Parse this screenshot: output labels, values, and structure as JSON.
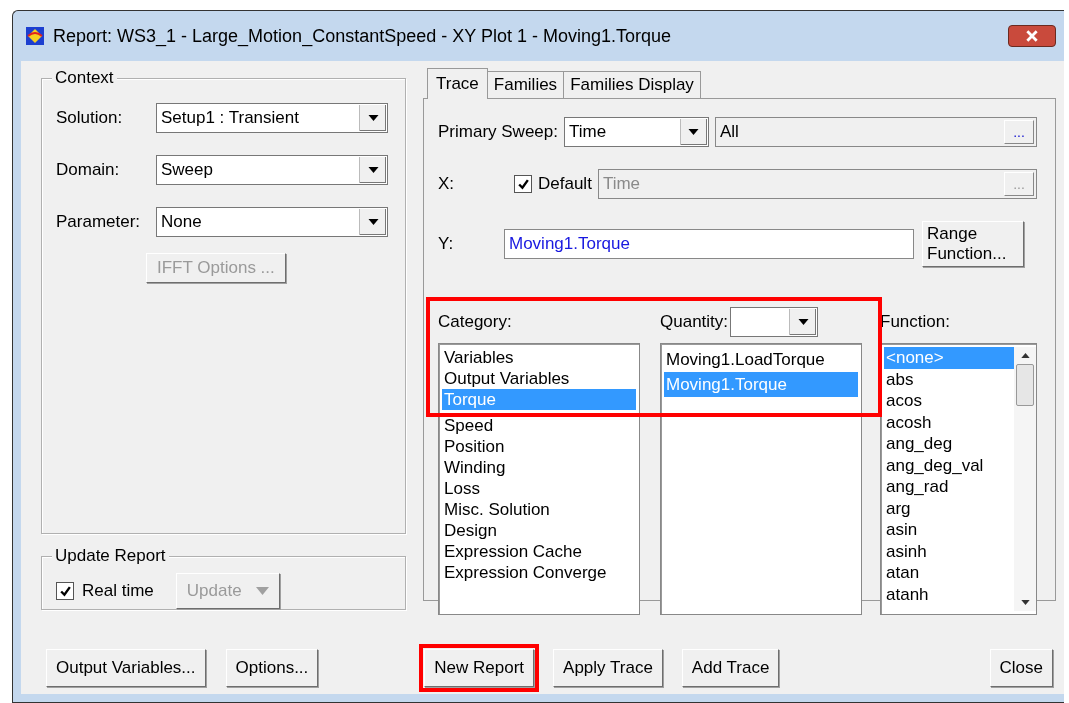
{
  "window": {
    "title": "Report: WS3_1 - Large_Motion_ConstantSpeed - XY Plot 1 - Moving1.Torque"
  },
  "context": {
    "legend": "Context",
    "fields": [
      {
        "label": "Solution:",
        "value": "Setup1 : Transient"
      },
      {
        "label": "Domain:",
        "value": "Sweep"
      },
      {
        "label": "Parameter:",
        "value": "None"
      }
    ],
    "ifft_button": {
      "label": "IFFT Options ...",
      "disabled": true
    }
  },
  "update_report": {
    "legend": "Update Report",
    "real_time": {
      "label": "Real time",
      "checked": true
    },
    "update_button": {
      "label": "Update",
      "disabled": true
    }
  },
  "tabs": [
    {
      "label": "Trace",
      "selected": true
    },
    {
      "label": "Families",
      "selected": false
    },
    {
      "label": "Families Display",
      "selected": false
    }
  ],
  "trace": {
    "primary_sweep": {
      "label": "Primary Sweep:",
      "value": "Time",
      "range": "All",
      "browse": "..."
    },
    "x": {
      "label": "X:",
      "default": {
        "label": "Default",
        "checked": true
      },
      "value": "Time",
      "browse": "...",
      "disabled": true
    },
    "y": {
      "label": "Y:",
      "value": "Moving1.Torque"
    },
    "range_function_button": "Range Function...",
    "selectors_highlighted": true,
    "category": {
      "label": "Category:",
      "items": [
        {
          "label": "Variables",
          "selected": false
        },
        {
          "label": "Output Variables",
          "selected": false
        },
        {
          "label": "Torque",
          "selected": true
        },
        {
          "label": "Speed",
          "selected": false
        },
        {
          "label": "Position",
          "selected": false
        },
        {
          "label": "Winding",
          "selected": false
        },
        {
          "label": "Loss",
          "selected": false
        },
        {
          "label": "Misc. Solution",
          "selected": false
        },
        {
          "label": "Design",
          "selected": false
        },
        {
          "label": "Expression Cache",
          "selected": false
        },
        {
          "label": "Expression Converge",
          "selected": false
        }
      ]
    },
    "quantity": {
      "label": "Quantity:",
      "items": [
        {
          "label": "Moving1.LoadTorque",
          "selected": false
        },
        {
          "label": "Moving1.Torque",
          "selected": true
        }
      ]
    },
    "function": {
      "label": "Function:",
      "items": [
        {
          "label": "<none>",
          "selected": true
        },
        {
          "label": "abs",
          "selected": false
        },
        {
          "label": "acos",
          "selected": false
        },
        {
          "label": "acosh",
          "selected": false
        },
        {
          "label": "ang_deg",
          "selected": false
        },
        {
          "label": "ang_deg_val",
          "selected": false
        },
        {
          "label": "ang_rad",
          "selected": false
        },
        {
          "label": "arg",
          "selected": false
        },
        {
          "label": "asin",
          "selected": false
        },
        {
          "label": "asinh",
          "selected": false
        },
        {
          "label": "atan",
          "selected": false
        },
        {
          "label": "atanh",
          "selected": false
        }
      ]
    }
  },
  "buttons": {
    "left": [
      {
        "label": "Output Variables...",
        "highlighted": false
      },
      {
        "label": "Options...",
        "highlighted": false
      }
    ],
    "middle": [
      {
        "label": "New Report",
        "highlighted": true
      },
      {
        "label": "Apply Trace",
        "highlighted": false
      },
      {
        "label": "Add Trace",
        "highlighted": false
      }
    ],
    "right": [
      {
        "label": "Close",
        "highlighted": false
      }
    ]
  }
}
